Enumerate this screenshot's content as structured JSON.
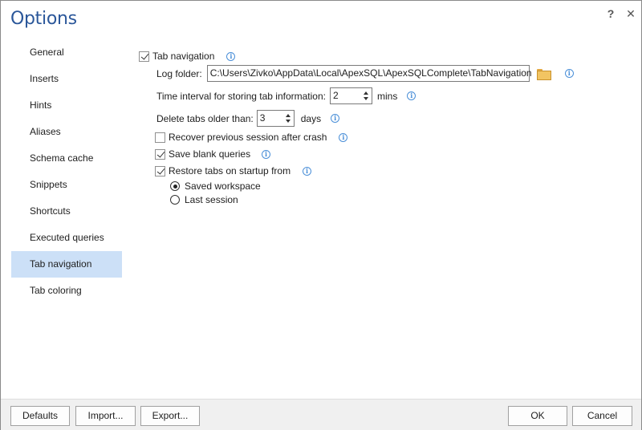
{
  "window": {
    "title": "Options",
    "help_glyph": "?",
    "close_glyph": "✕"
  },
  "nav": {
    "items": [
      {
        "label": "General"
      },
      {
        "label": "Inserts"
      },
      {
        "label": "Hints"
      },
      {
        "label": "Aliases"
      },
      {
        "label": "Schema cache"
      },
      {
        "label": "Snippets"
      },
      {
        "label": "Shortcuts"
      },
      {
        "label": "Executed queries"
      },
      {
        "label": "Tab navigation"
      },
      {
        "label": "Tab coloring"
      }
    ],
    "active": "Tab navigation"
  },
  "settings": {
    "tab_navigation": {
      "label": "Tab navigation",
      "checked": true
    },
    "log_folder": {
      "label": "Log folder:",
      "value": "C:\\Users\\Zivko\\AppData\\Local\\ApexSQL\\ApexSQLComplete\\TabNavigation"
    },
    "time_interval": {
      "label": "Time interval for storing tab information:",
      "value": "2",
      "unit": "mins"
    },
    "delete_tabs": {
      "label": "Delete tabs older than:",
      "value": "3",
      "unit": "days"
    },
    "recover_session": {
      "label": "Recover previous session after crash",
      "checked": false
    },
    "save_blank": {
      "label": "Save blank queries",
      "checked": true
    },
    "restore_tabs": {
      "label": "Restore tabs on startup from",
      "checked": true
    },
    "restore_options": {
      "saved_workspace": {
        "label": "Saved workspace",
        "selected": true
      },
      "last_session": {
        "label": "Last session",
        "selected": false
      }
    },
    "info_glyph": "i"
  },
  "footer": {
    "defaults": "Defaults",
    "import": "Import...",
    "export": "Export...",
    "ok": "OK",
    "cancel": "Cancel"
  },
  "colors": {
    "title": "#2b579a",
    "nav_active_bg": "#cce0f7",
    "info": "#4a8fd8"
  }
}
